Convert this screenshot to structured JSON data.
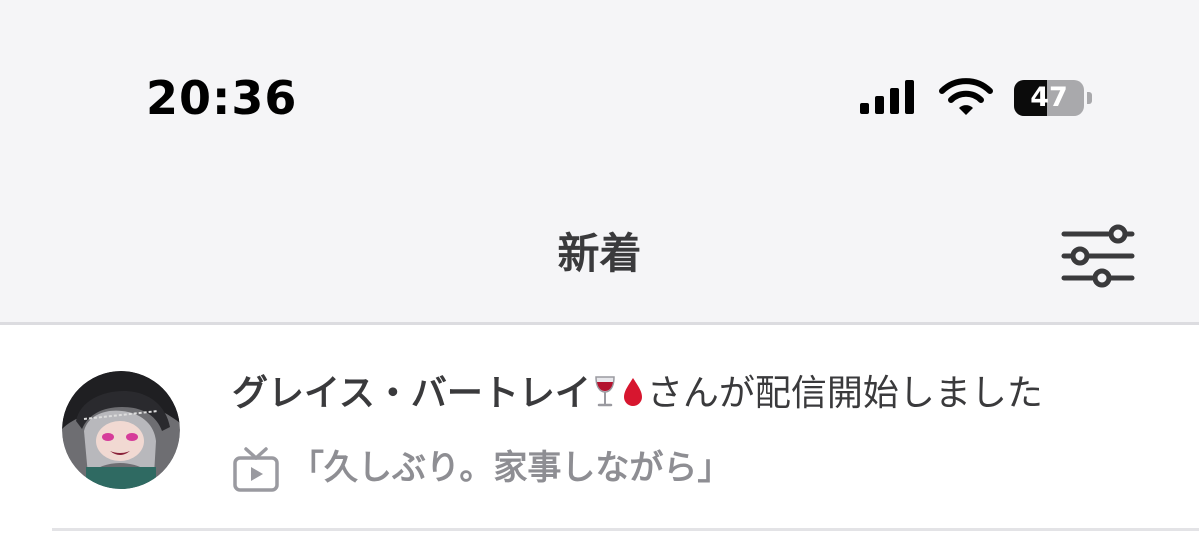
{
  "status_bar": {
    "time": "20:36",
    "battery_level": "47",
    "battery_fraction": 0.47,
    "icons": [
      "signal-bars-icon",
      "wifi-icon",
      "battery-icon"
    ]
  },
  "nav": {
    "title": "新着",
    "filter_icon": "sliders-icon"
  },
  "notifications": [
    {
      "user_name": "グレイス・バートレイ",
      "emojis": [
        "wine-glass-emoji",
        "blood-drop-emoji"
      ],
      "action": "さんが配信開始しました",
      "stream_icon": "tv-icon",
      "stream_title": "「久しぶり。家事しながら」"
    }
  ],
  "colors": {
    "header_bg": "#f5f5f7",
    "text_primary": "#3a3a3c",
    "text_secondary": "#8e8e93",
    "divider": "#dcdce0"
  }
}
